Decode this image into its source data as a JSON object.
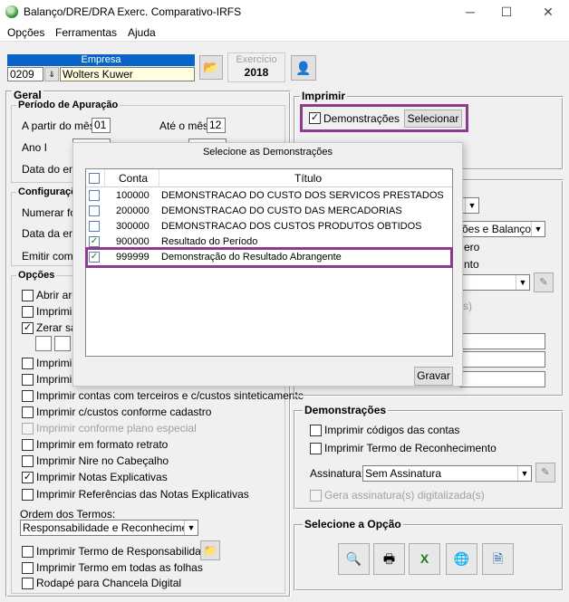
{
  "window": {
    "title": "Balanço/DRE/DRA Exerc. Comparativo-IRFS",
    "minimize": "─",
    "maximize": "☐",
    "close": "✕"
  },
  "menu": {
    "opcoes": "Opções",
    "ferramentas": "Ferramentas",
    "ajuda": "Ajuda"
  },
  "empresa": {
    "label": "Empresa",
    "code": "0209",
    "name": "Wolters Kuwer"
  },
  "exercicio": {
    "label": "Exercício",
    "value": "2018"
  },
  "geral": {
    "label": "Geral",
    "periodo": {
      "label": "Período de Apuração",
      "a_partir_label": "A partir do mês",
      "a_partir_value": "01",
      "ate_label": "Até o mês",
      "ate_value": "12",
      "ano_label": "Ano I",
      "data_label": "Data do enc"
    },
    "configuracoes": {
      "label": "Configuraçõ",
      "numerar_label": "Numerar foll",
      "data_emissao_label": "Data da emis",
      "emitir_label": "Emitir como:"
    }
  },
  "opcoes": {
    "label": "Opções",
    "items": [
      {
        "label": "Abrir arq",
        "checked": false,
        "disabled": false
      },
      {
        "label": "Imprimir r",
        "checked": false,
        "disabled": false
      },
      {
        "label": "Zerar sal",
        "checked": true,
        "disabled": false
      },
      {
        "label": "Imprimir c",
        "checked": false,
        "disabled": false
      },
      {
        "label": "Imprimir c",
        "checked": false,
        "disabled": false
      },
      {
        "label": "Imprimir contas com terceiros e c/custos sinteticamente",
        "checked": false,
        "disabled": false
      },
      {
        "label": "Imprimir c/custos conforme cadastro",
        "checked": false,
        "disabled": false
      },
      {
        "label": "Imprimir conforme plano especial",
        "checked": false,
        "disabled": true
      },
      {
        "label": "Imprimir em formato retrato",
        "checked": false,
        "disabled": false
      },
      {
        "label": "Imprimir Nire no Cabeçalho",
        "checked": false,
        "disabled": false
      },
      {
        "label": "Imprimir Notas Explicativas",
        "checked": true,
        "disabled": false
      },
      {
        "label": "Imprimir Referências das Notas Explicativas",
        "checked": false,
        "disabled": false
      }
    ],
    "ordem_label": "Ordem dos Termos:",
    "ordem_value": "Responsabilidade e Reconhecimento",
    "termo_resp": "Imprimir Termo de Responsabilidade",
    "termo_todas": "Imprimir Termo em todas as folhas",
    "rodape": "Rodapé para Chancela Digital"
  },
  "imprimir": {
    "label": "Imprimir",
    "demonstracoes_label": "Demonstrações",
    "selecionar_label": "Selecionar"
  },
  "right_partial": {
    "combo2_text": "ões e Balanço",
    "txt_ero": "ero",
    "txt_nto": "nto",
    "txt_s": "s)"
  },
  "demonstracoes": {
    "label": "Demonstrações",
    "codigos": "Imprimir códigos das contas",
    "termo_rec": "Imprimir Termo de Reconhecimento",
    "assinatura_label": "Assinatura:",
    "assinatura_value": "Sem Assinatura",
    "gera_assinatura": "Gera assinatura(s) digitalizada(s)"
  },
  "selecione_opcao": {
    "label": "Selecione a Opção"
  },
  "dialog": {
    "title": "Selecione as Demonstrações",
    "col_conta": "Conta",
    "col_titulo": "Título",
    "rows": [
      {
        "conta": "100000",
        "titulo": "DEMONSTRACAO DO CUSTO DOS SERVICOS PRESTADOS",
        "checked": false
      },
      {
        "conta": "200000",
        "titulo": "DEMONSTRACAO DO CUSTO DAS MERCADORIAS",
        "checked": false
      },
      {
        "conta": "300000",
        "titulo": "DEMONSTRACAO DOS CUSTOS PRODUTOS OBTIDOS",
        "checked": false
      },
      {
        "conta": "900000",
        "titulo": "Resultado do Período",
        "checked": true
      },
      {
        "conta": "999999",
        "titulo": "Demonstração do Resultado Abrangente",
        "checked": true
      }
    ],
    "gravar_label": "Gravar"
  }
}
